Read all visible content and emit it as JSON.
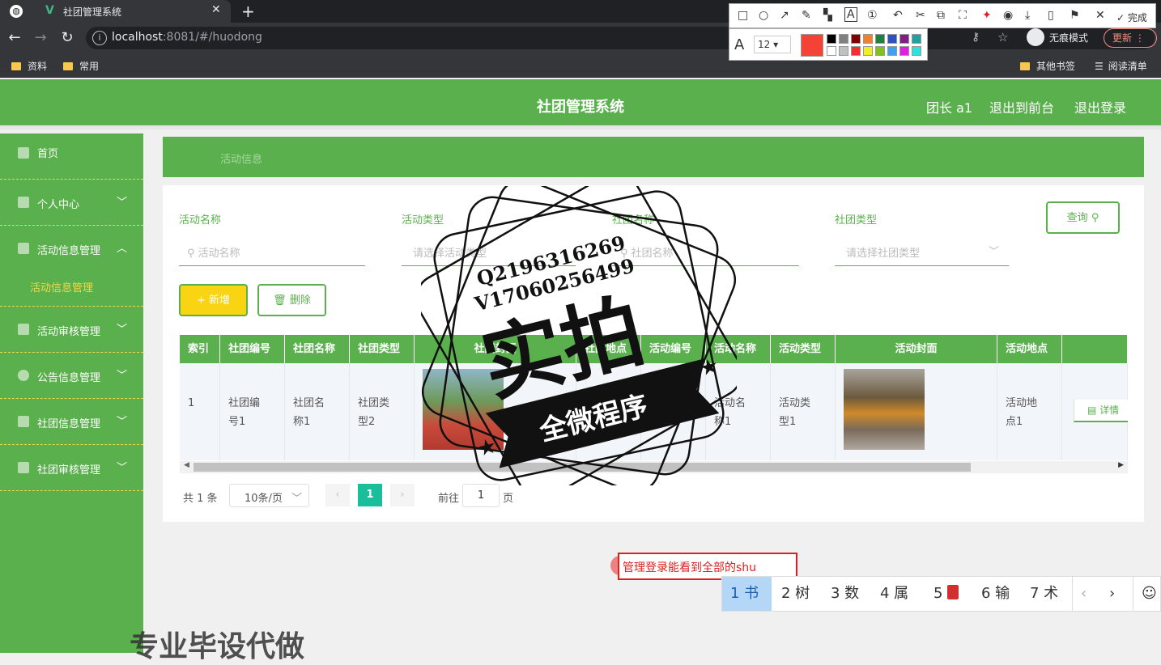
{
  "browser": {
    "tab_title": "社团管理系统",
    "tab_close": "✕",
    "new_tab": "+",
    "url_host": "localhost",
    "url_port": ":8081",
    "url_path": "/#/huodong",
    "incognito": "无痕模式",
    "update": "更新",
    "bookmarks": [
      "资料",
      "常用"
    ],
    "bookmarks_right": [
      "其他书签",
      "阅读清单"
    ]
  },
  "snap_toolbar": {
    "done": "完成",
    "font_size": "12"
  },
  "header": {
    "title": "社团管理系统",
    "user": "团长 a1",
    "front": "退出到前台",
    "logout": "退出登录"
  },
  "sidebar": {
    "items": [
      {
        "label": "首页"
      },
      {
        "label": "个人中心"
      },
      {
        "label": "活动信息管理"
      },
      {
        "label": "活动信息管理"
      },
      {
        "label": "活动审核管理"
      },
      {
        "label": "公告信息管理"
      },
      {
        "label": "社团信息管理"
      },
      {
        "label": "社团审核管理"
      }
    ]
  },
  "breadcrumb": "活动信息",
  "filters": {
    "f1_label": "活动名称",
    "f1_ph": "活动名称",
    "f2_label": "活动类型",
    "f2_ph": "请选择活动类型",
    "f3_label": "社团名称",
    "f3_ph": "社团名称",
    "f4_label": "社团类型",
    "f4_ph": "请选择社团类型",
    "query": "查询"
  },
  "actions": {
    "add": "新增",
    "delete": "删除"
  },
  "table": {
    "headers": [
      "索引",
      "社团编号",
      "社团名称",
      "社团类型",
      "社团封面",
      "社团地点",
      "活动编号",
      "活动名称",
      "活动类型",
      "活动封面",
      "活动地点"
    ],
    "row": {
      "index": "1",
      "club_no": "社团编号1",
      "club_name": "社团名称1",
      "club_type": "社团类型2",
      "act_no": "活动编号1",
      "act_name": "活动名称1",
      "act_type": "活动类型1",
      "act_place": "活动地点1",
      "detail": "详情"
    }
  },
  "pagination": {
    "total": "共 1 条",
    "size": "10条/页",
    "page": "1",
    "goto": "前往",
    "goto_val": "1",
    "page_unit": "页"
  },
  "stamp": {
    "qq": "Q2196316269",
    "wx": "V17060256499",
    "big": "实拍",
    "banner": "全微程序"
  },
  "ime": {
    "input": "管理登录能看到全部的shu",
    "candidates": [
      "1 书",
      "2 树",
      "3 数",
      "4 属",
      "5",
      "6 输",
      "7 术"
    ]
  },
  "watermark": "专业毕设代做",
  "colors": {
    "green": "#5bb04e",
    "yellow": "#f5d742",
    "page_active": "#19be9b"
  }
}
